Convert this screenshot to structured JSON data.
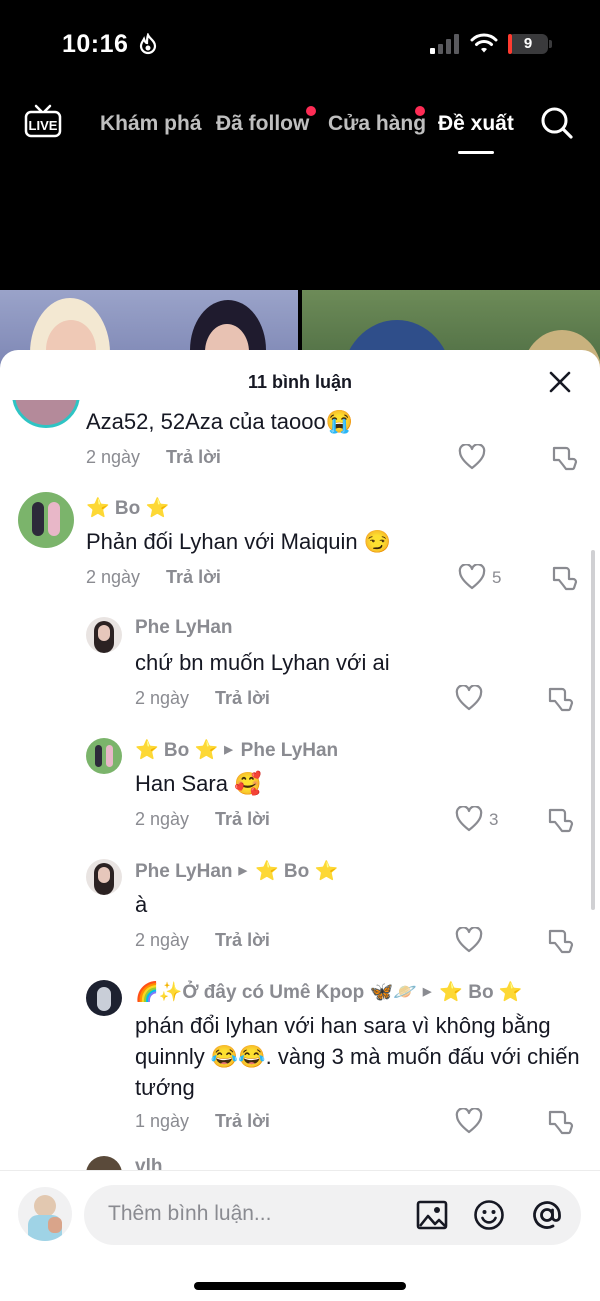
{
  "status_bar": {
    "time": "10:16",
    "battery_level": "9",
    "battery_fraction": 0.09
  },
  "top_nav": {
    "items": [
      {
        "label": "Khám phá",
        "has_dot": false,
        "active": false
      },
      {
        "label": "Đã follow",
        "has_dot": true,
        "active": false
      },
      {
        "label": "Cửa hàng",
        "has_dot": true,
        "active": false
      },
      {
        "label": "Đề xuất",
        "has_dot": false,
        "active": true
      }
    ],
    "live_label": "LIVE",
    "accent_color": "#fe2c55"
  },
  "comment_sheet": {
    "title": "11 bình luận",
    "comments": [
      {
        "username": "",
        "text": "Aza52, 52Aza của taooo😭",
        "time": "2 ngày",
        "reply_label": "Trả lời",
        "likes": ""
      },
      {
        "username": "⭐ Bo ⭐",
        "text": "Phản đối Lyhan với Maiquin 😏",
        "time": "2 ngày",
        "reply_label": "Trả lời",
        "likes": "5"
      },
      {
        "username": "Phe LyHan",
        "text": "chứ bn muốn Lyhan với ai",
        "time": "2 ngày",
        "reply_label": "Trả lời",
        "likes": ""
      },
      {
        "username": "⭐ Bo ⭐",
        "reply_to": "Phe LyHan",
        "text": "Han Sara 🥰",
        "time": "2 ngày",
        "reply_label": "Trả lời",
        "likes": "3"
      },
      {
        "username": "Phe LyHan",
        "reply_to": "⭐ Bo ⭐",
        "text": "à",
        "time": "2 ngày",
        "reply_label": "Trả lời",
        "likes": ""
      },
      {
        "username": "🌈✨Ở đây có Umê Kpop 🦋🪐",
        "reply_to": "⭐ Bo ⭐",
        "text": "phán đổi lyhan với han sara vì không bằng quinnly 😂😂. vàng 3 mà muốn đấu với chiến tướng",
        "time": "1 ngày",
        "reply_label": "Trả lời",
        "likes": ""
      },
      {
        "username": "vlh",
        "text": "",
        "time": "",
        "reply_label": "",
        "likes": ""
      }
    ]
  },
  "comment_input": {
    "placeholder": "Thêm bình luận..."
  }
}
